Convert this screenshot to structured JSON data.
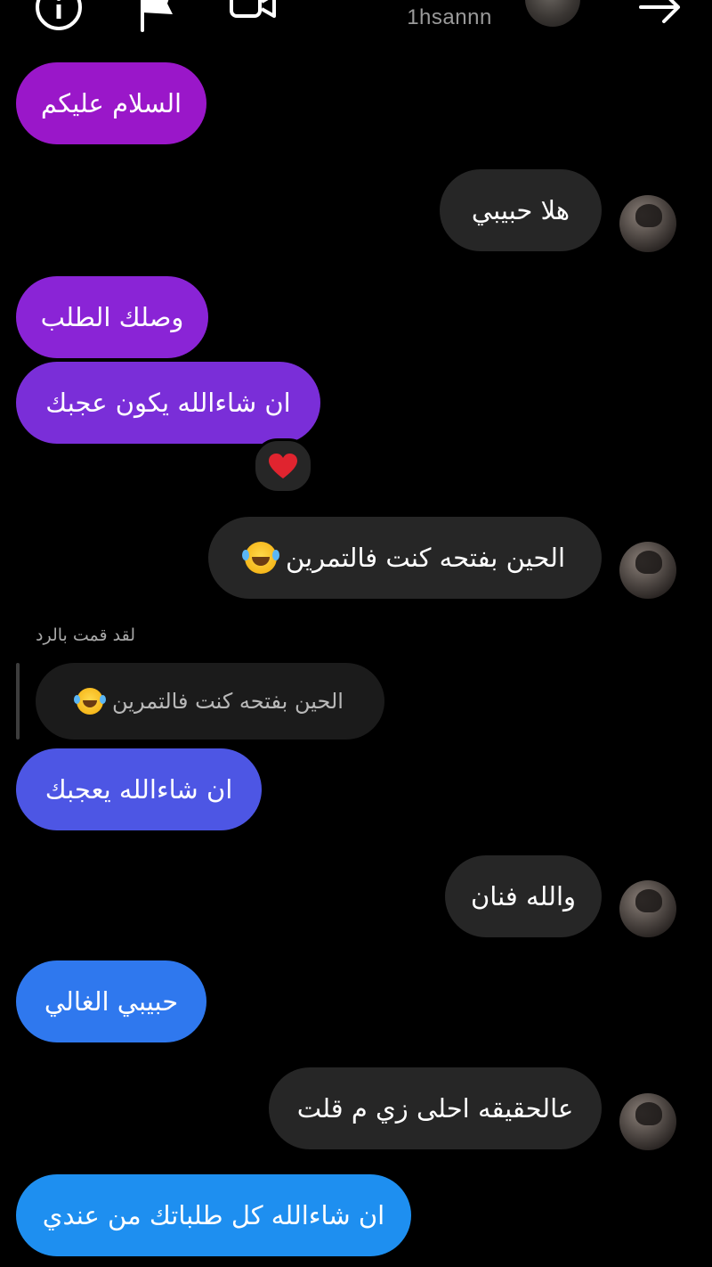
{
  "header": {
    "username": "1hsannn",
    "icons": [
      "info-icon",
      "flag-icon",
      "video-call-icon",
      "back-arrow-icon"
    ]
  },
  "messages": [
    {
      "side": "sent",
      "text": "السلام عليكم",
      "color": "#9a17c9"
    },
    {
      "side": "received",
      "text": "هلا حبيبي"
    },
    {
      "side": "sent",
      "text": "وصلك الطلب",
      "color": "#8a24d6"
    },
    {
      "side": "sent",
      "text": "ان شاءالله يكون عجبك",
      "color": "#7a2ed8",
      "reaction": "heart"
    },
    {
      "side": "received",
      "text": "الحين بفتحه كنت فالتمرين",
      "emoji": "laughing-emoji"
    },
    {
      "side": "sent",
      "text": "ان شاءالله يعجبك",
      "color": "#4d56e4",
      "reply": {
        "note": "لقد قمت بالرد",
        "quoted_text": "الحين بفتحه كنت فالتمرين",
        "emoji": "laughing-emoji"
      }
    },
    {
      "side": "received",
      "text": "والله فنان"
    },
    {
      "side": "sent",
      "text": "حبيبي الغالي",
      "color": "#2f78ee"
    },
    {
      "side": "received",
      "text": "عالحقيقه احلى زي م قلت"
    },
    {
      "side": "sent",
      "text": "ان شاءالله كل طلباتك من عندي",
      "color": "#1e8ff0"
    }
  ],
  "colors": {
    "background": "#000000",
    "received_bubble": "#262626",
    "reaction_heart": "#e0242f"
  }
}
